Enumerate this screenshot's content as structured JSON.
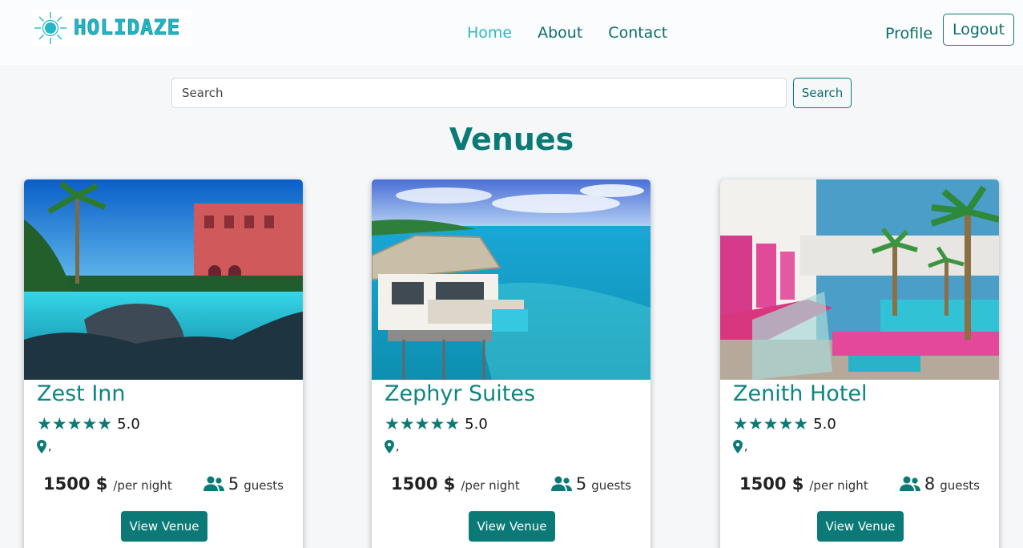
{
  "brand": {
    "name": "HOLIDAZE"
  },
  "nav": {
    "links": [
      "Home",
      "About",
      "Contact"
    ],
    "active": "Home",
    "profile_label": "Profile",
    "logout_label": "Logout"
  },
  "search": {
    "placeholder": "Search",
    "button_label": "Search"
  },
  "page_title": "Venues",
  "colors": {
    "accent": "#0b7a76",
    "active_link": "#2bb6c7",
    "title_teal": "#0e8580"
  },
  "venues": [
    {
      "name": "Zest Inn",
      "stars": "★★★★★",
      "rating": "5.0",
      "location": ",",
      "price": "1500 $",
      "per_night": "/per night",
      "guests": "5",
      "guests_label": "guests",
      "button_label": "View Venue",
      "image": "resort-pool-photo"
    },
    {
      "name": "Zephyr Suites",
      "stars": "★★★★★",
      "rating": "5.0",
      "location": ",",
      "price": "1500 $",
      "per_night": "/per night",
      "guests": "5",
      "guests_label": "guests",
      "button_label": "View Venue",
      "image": "overwater-villa-photo"
    },
    {
      "name": "Zenith Hotel",
      "stars": "★★★★★",
      "rating": "5.0",
      "location": ",",
      "price": "1500 $",
      "per_night": "/per night",
      "guests": "8",
      "guests_label": "guests",
      "button_label": "View Venue",
      "image": "pink-pool-hotel-photo"
    }
  ]
}
